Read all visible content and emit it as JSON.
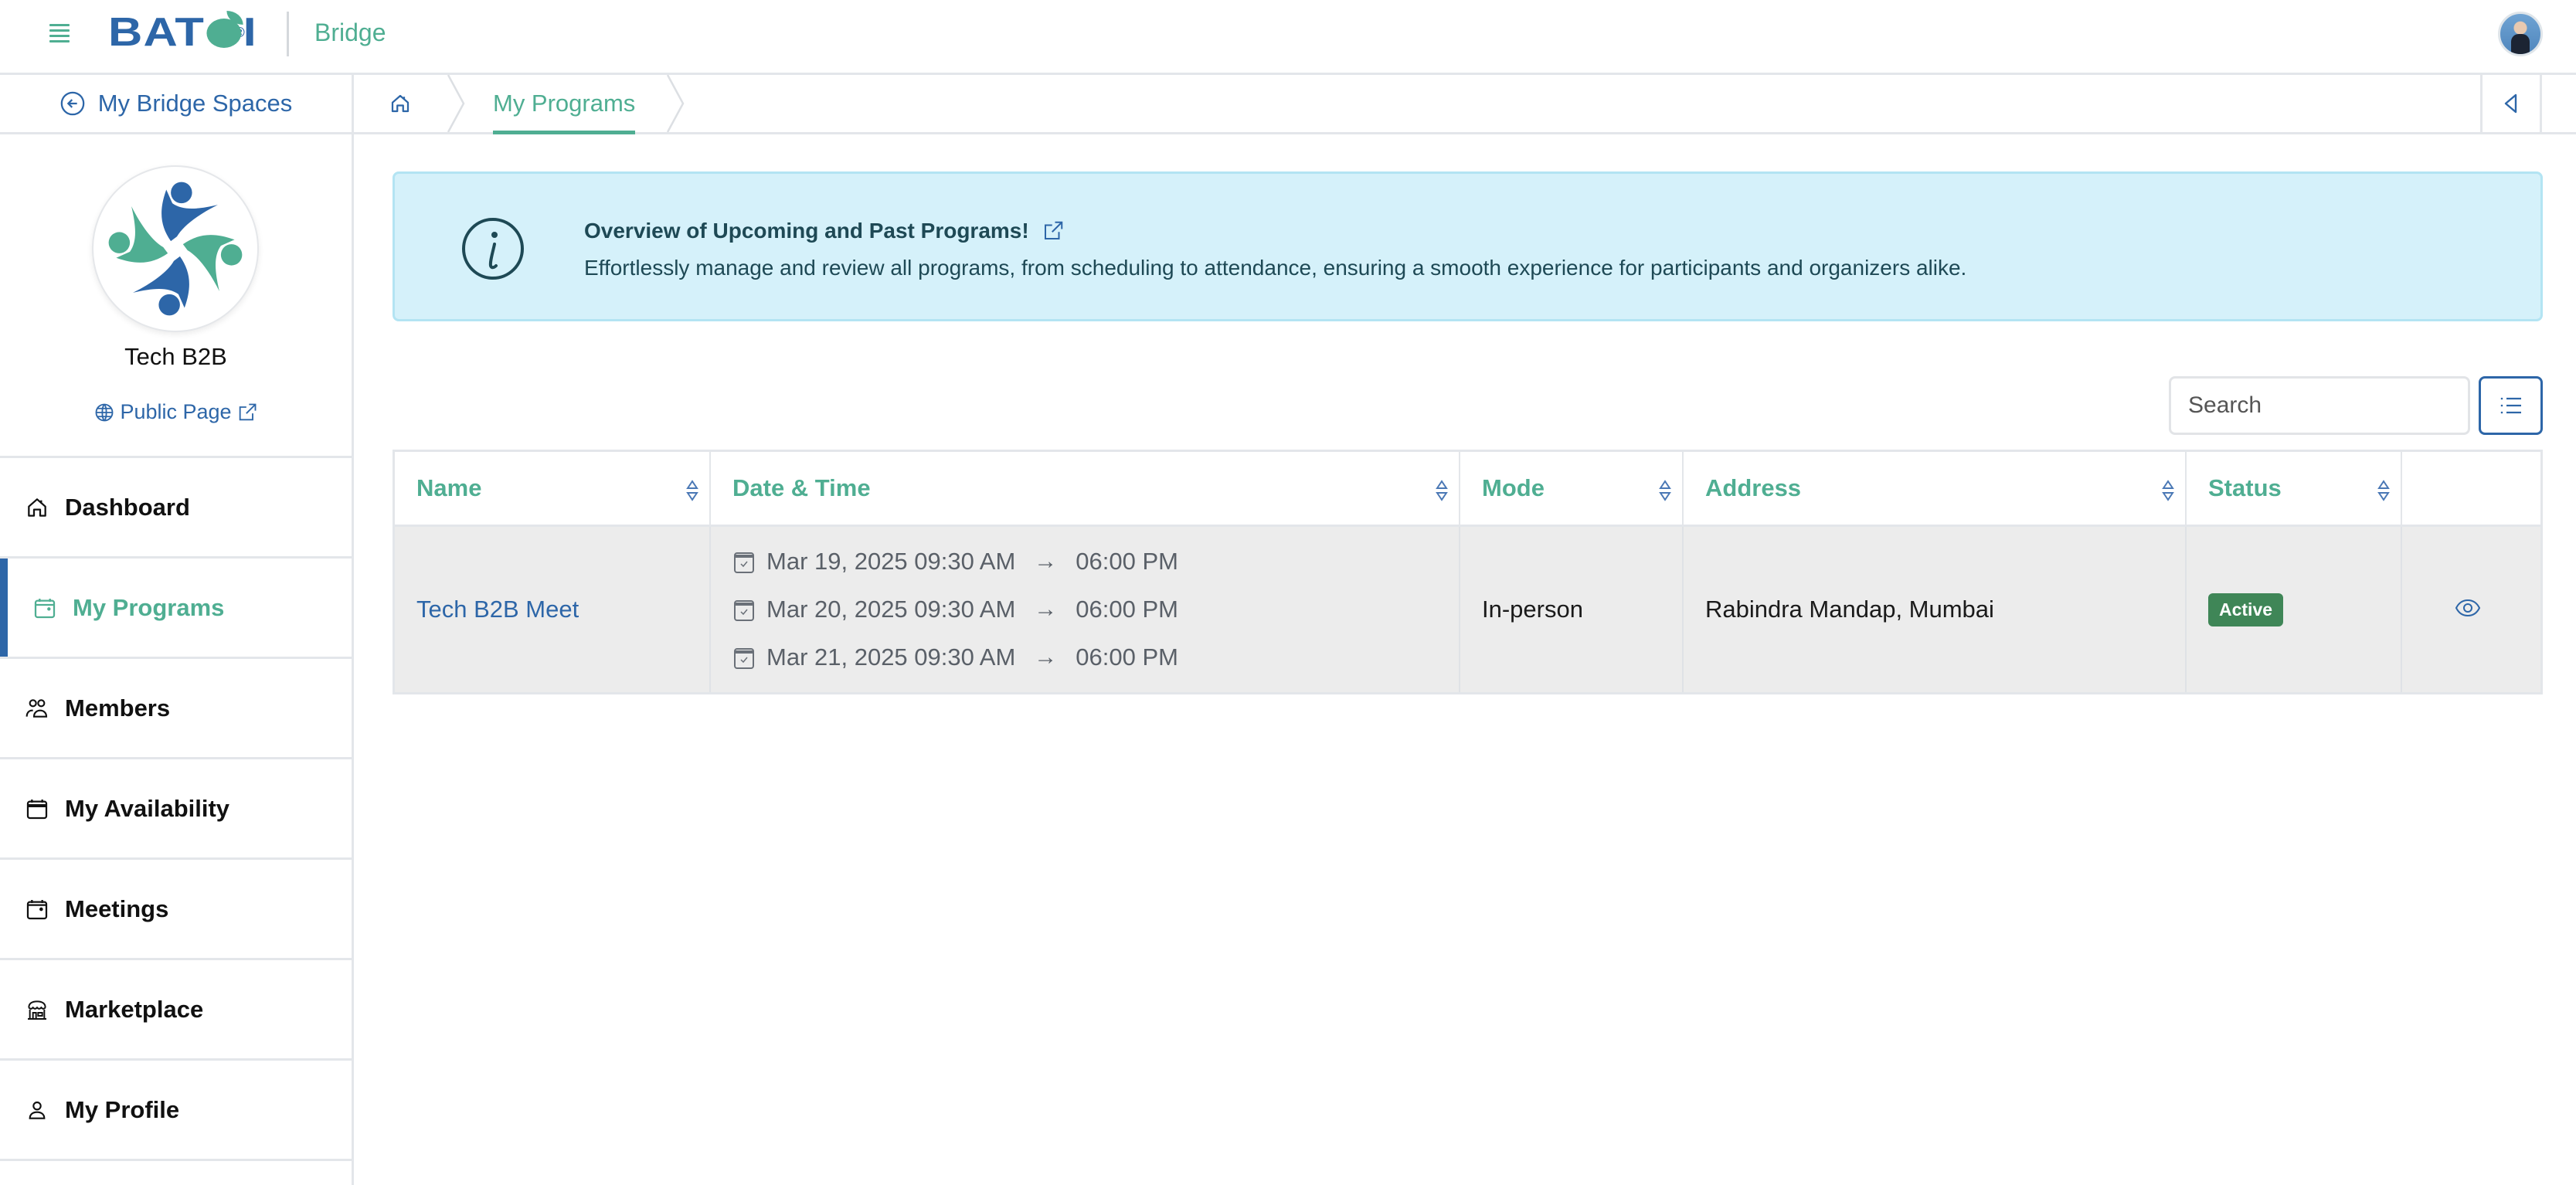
{
  "header": {
    "brand_logo_text": "BATOI",
    "brand_logo_mark": "®",
    "app_name": "Bridge",
    "menu_icon": "hamburger-icon",
    "user_avatar": "user-avatar"
  },
  "subheader": {
    "back_label": "My Bridge Spaces",
    "back_icon": "arrow-left-circle-icon",
    "breadcrumb": [
      {
        "type": "icon",
        "icon": "home-icon"
      },
      {
        "type": "text",
        "label": "My Programs"
      }
    ],
    "collapse_icon": "caret-left-icon"
  },
  "sidebar": {
    "space_name": "Tech B2B",
    "public_page_label": "Public Page",
    "items": [
      {
        "label": "Dashboard",
        "icon": "home-icon",
        "active": false
      },
      {
        "label": "My Programs",
        "icon": "calendar-icon",
        "active": true
      },
      {
        "label": "Members",
        "icon": "users-icon",
        "active": false
      },
      {
        "label": "My Availability",
        "icon": "calendar-availability-icon",
        "active": false
      },
      {
        "label": "Meetings",
        "icon": "calendar-meetings-icon",
        "active": false
      },
      {
        "label": "Marketplace",
        "icon": "store-icon",
        "active": false
      },
      {
        "label": "My Profile",
        "icon": "user-icon",
        "active": false
      }
    ]
  },
  "banner": {
    "title": "Overview of Upcoming and Past Programs!",
    "description": "Effortlessly manage and review all programs, from scheduling to attendance, ensuring a smooth experience for participants and organizers alike."
  },
  "toolbar": {
    "search_placeholder": "Search",
    "search_value": "",
    "list_view_icon": "list-icon"
  },
  "table": {
    "columns": [
      "Name",
      "Date & Time",
      "Mode",
      "Address",
      "Status",
      ""
    ],
    "rows": [
      {
        "name": "Tech B2B Meet",
        "dates": [
          {
            "start": "Mar 19, 2025 09:30 AM",
            "end": "06:00 PM"
          },
          {
            "start": "Mar 20, 2025 09:30 AM",
            "end": "06:00 PM"
          },
          {
            "start": "Mar 21, 2025 09:30 AM",
            "end": "06:00 PM"
          }
        ],
        "mode": "In-person",
        "address": "Rabindra Mandap, Mumbai",
        "status": "Active"
      }
    ]
  },
  "colors": {
    "brand_blue": "#2d66a8",
    "brand_green": "#4fae92",
    "banner_bg": "#d5f1fa",
    "status_active": "#3f8657",
    "row_bg": "#ececec"
  }
}
